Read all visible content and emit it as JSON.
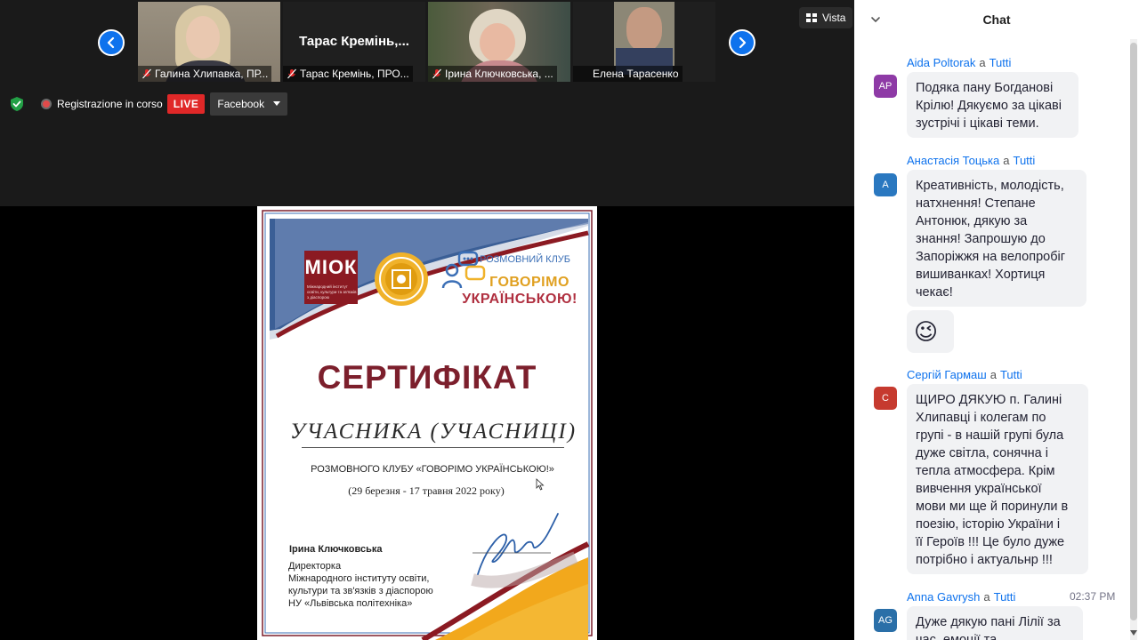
{
  "meeting": {
    "participants": [
      {
        "name": "Галина Хлипавка, ПР...",
        "muted": true,
        "video": true
      },
      {
        "name": "Тарас Кремінь, ПРО...",
        "display_name": "Тарас Кремінь,...",
        "muted": true,
        "video": false
      },
      {
        "name": "Ірина Ключковська, ...",
        "muted": true,
        "video": true
      },
      {
        "name": "Елена Тарасенко",
        "muted": false,
        "video": true
      }
    ],
    "view_label": "Vista",
    "recording_label": "Registrazione in corso",
    "live_badge": "LIVE",
    "stream_target": "Facebook",
    "colors": {
      "accent": "#0e72ed",
      "live": "#e02828",
      "shield": "#23a046"
    }
  },
  "certificate": {
    "logo_text": "МІОК",
    "logo_sub": "Міжнародний інститут освіти, культури та зв'язків з діаспорою",
    "club_label": "РОЗМОВНИЙ КЛУБ",
    "club_title_line1": "ГОВОРІМО",
    "club_title_line2": "УКРАЇНСЬКОЮ!",
    "title": "СЕРТИФІКАТ",
    "subtitle": "УЧАСНИКА (УЧАСНИЦІ)",
    "club_name": "РОЗМОВНОГО КЛУБУ «ГОВОРІМО УКРАЇНСЬКОЮ!»",
    "dates": "(29 березня - 17 травня 2022 року)",
    "signer": "Ірина Ключковська",
    "role_lines": [
      "Директорка",
      "Міжнародного інституту освіти,",
      "культури та зв'язків з діаспорою",
      "НУ «Львівська політехніка»"
    ]
  },
  "chat": {
    "title": "Chat",
    "to_word": "a",
    "messages": [
      {
        "initials": "AP",
        "avatar_color": "#8e3aa6",
        "sender": "Aida Poltorak",
        "to": "Tutti",
        "time": "",
        "lines": [
          "Подяка пану Богданові",
          "Крілю! Дякуємо за цікаві",
          "зустрічі і цікаві теми."
        ]
      },
      {
        "initials": "A",
        "avatar_color": "#2a78c0",
        "sender": "Анастасія Тоцька",
        "to": "Tutti",
        "time": "",
        "lines": [
          "Креативність, молодість,",
          "натхнення! Степане",
          "Антонюк, дякую за",
          "знання! Запрошую до",
          "Запоріжжя на велопробіг",
          "вишиванках! Хортиця",
          "чекає!"
        ],
        "emoji": "😉"
      },
      {
        "initials": "С",
        "avatar_color": "#c63a2f",
        "sender": "Сергій Гармаш",
        "to": "Tutti",
        "time": "",
        "lines": [
          "ЩИРО ДЯКУЮ п. Галині",
          "Хлипавці і колегам по",
          "групі - в нашій групі була",
          "дуже світла, сонячна і",
          "тепла атмосфера. Крім",
          "вивчення української",
          "мови ми ще й поринули в",
          "поезію, історію України і",
          "її Героїв !!! Це було дуже",
          "потрібно і актуальнр !!!"
        ]
      },
      {
        "initials": "AG",
        "avatar_color": "#2a6fa8",
        "sender": "Anna Gavrysh",
        "to": "Tutti",
        "time": "02:37 PM",
        "lines": [
          "Дуже дякую пані Лілії за",
          "час, емоції та"
        ]
      }
    ]
  }
}
